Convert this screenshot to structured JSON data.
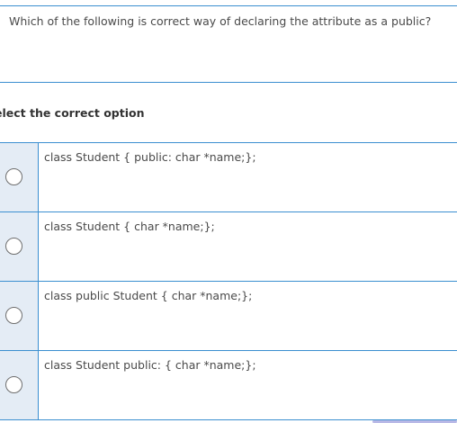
{
  "question": {
    "text": "Which of the following is correct way of declaring the attribute as a public?"
  },
  "select_heading": "elect the correct option",
  "options": [
    {
      "label": "class Student { public: char *name;};"
    },
    {
      "label": "class Student { char *name;};"
    },
    {
      "label": "class public Student { char *name;};"
    },
    {
      "label": "class Student public: { char *name;};"
    }
  ],
  "colors": {
    "border": "#3b8fd0",
    "radio_cell_bg": "#e4ecf5",
    "text": "#4a4a4a"
  }
}
